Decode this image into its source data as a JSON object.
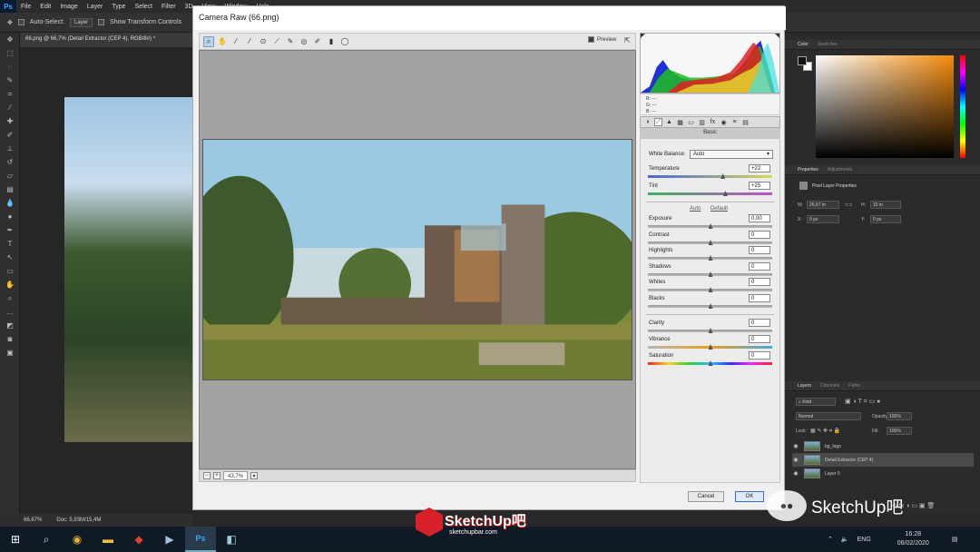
{
  "menubar": {
    "app_logo": "Ps",
    "items": [
      "File",
      "Edit",
      "Image",
      "Layer",
      "Type",
      "Select",
      "Filter",
      "3D",
      "View",
      "Window",
      "Help"
    ]
  },
  "options": {
    "auto_select_label": "Auto-Select:",
    "auto_select_target": "Layer",
    "transform_label": "Show Transform Controls"
  },
  "document": {
    "tab_title": "66.png @ 66,7% (Detail Extractor (CEP 4), RGB/8#) *",
    "zoom": "66,67%",
    "doc_size": "Doc: 5,93M/15,4M"
  },
  "camera_raw": {
    "title": "Camera Raw (66.png)",
    "preview_label": "Preview",
    "zoom_value": "43,7%",
    "rgb_readout": {
      "r": "R:  ---",
      "g": "G:  ---",
      "b": "B:  ---"
    },
    "panel_title": "Basic",
    "white_balance": {
      "label": "White Balance:",
      "value": "Auto"
    },
    "temperature": {
      "label": "Temperature",
      "value": "+22",
      "pos": 0.6
    },
    "tint": {
      "label": "Tint",
      "value": "+25",
      "pos": 0.62
    },
    "auto_link": "Auto",
    "default_link": "Default",
    "exposure": {
      "label": "Exposure",
      "value": "0,00",
      "pos": 0.5
    },
    "contrast": {
      "label": "Contrast",
      "value": "0",
      "pos": 0.5
    },
    "highlights": {
      "label": "Highlights",
      "value": "0",
      "pos": 0.5
    },
    "shadows": {
      "label": "Shadows",
      "value": "0",
      "pos": 0.5
    },
    "whites": {
      "label": "Whites",
      "value": "0",
      "pos": 0.5
    },
    "blacks": {
      "label": "Blacks",
      "value": "0",
      "pos": 0.5
    },
    "clarity": {
      "label": "Clarity",
      "value": "0",
      "pos": 0.5
    },
    "vibrance": {
      "label": "Vibrance",
      "value": "0",
      "pos": 0.5
    },
    "saturation": {
      "label": "Saturation",
      "value": "0",
      "pos": 0.5
    },
    "cancel_label": "Cancel",
    "ok_label": "OK"
  },
  "right_panel": {
    "color_tabs": [
      "Color",
      "Swatches"
    ],
    "properties_tabs": [
      "Properties",
      "Adjustments"
    ],
    "pixel_layer_title": "Pixel Layer Properties",
    "w_label": "W:",
    "w_value": "26,67 in",
    "h_label": "H:",
    "h_value": "15 in",
    "x_label": "X:",
    "x_value": "0 px",
    "y_label": "Y:",
    "y_value": "0 px",
    "layer_tabs": [
      "Layers",
      "Channels",
      "Paths"
    ],
    "kind_label": "Kind",
    "blend_mode": "Normal",
    "opacity_label": "Opacity:",
    "opacity_value": "100%",
    "lock_label": "Lock:",
    "fill_label": "Fill:",
    "fill_value": "100%",
    "layers": [
      {
        "name": "bg_logo"
      },
      {
        "name": "Detail Extractor (CEP 4)"
      },
      {
        "name": "Layer 0"
      }
    ]
  },
  "watermark": {
    "brand": "SketchUp吧",
    "domain": "sketchupbar.com",
    "channel": "SketchUp吧"
  },
  "taskbar": {
    "lang": "ENG",
    "time": "16:28",
    "date": "06/02/2020"
  },
  "colors": {
    "accent": "#31a8ff",
    "ok_border": "#3b6fbf"
  }
}
